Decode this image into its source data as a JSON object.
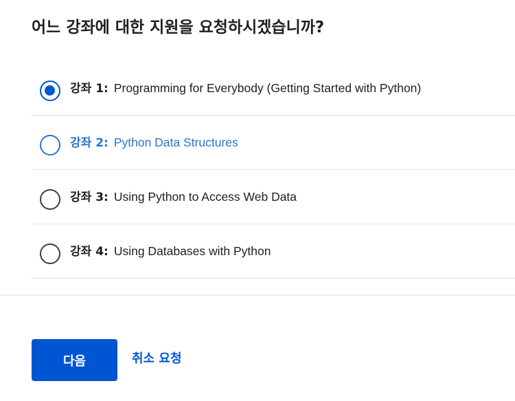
{
  "question": {
    "title": "어느 강좌에 대한 지원을 요청하시겠습니까?"
  },
  "options": [
    {
      "prefix": "강좌 1:",
      "label": "Programming for Everybody (Getting Started with Python)",
      "selected": true
    },
    {
      "prefix": "강좌 2:",
      "label": "Python Data Structures",
      "selected": false
    },
    {
      "prefix": "강좌 3:",
      "label": "Using Python to Access Web Data",
      "selected": false
    },
    {
      "prefix": "강좌 4:",
      "label": "Using Databases with Python",
      "selected": false
    }
  ],
  "actions": {
    "next_label": "다음",
    "cancel_label": "취소 요청"
  },
  "colors": {
    "accent": "#0056d2",
    "hover": "#2a73cc",
    "text": "#1f1f1f"
  }
}
